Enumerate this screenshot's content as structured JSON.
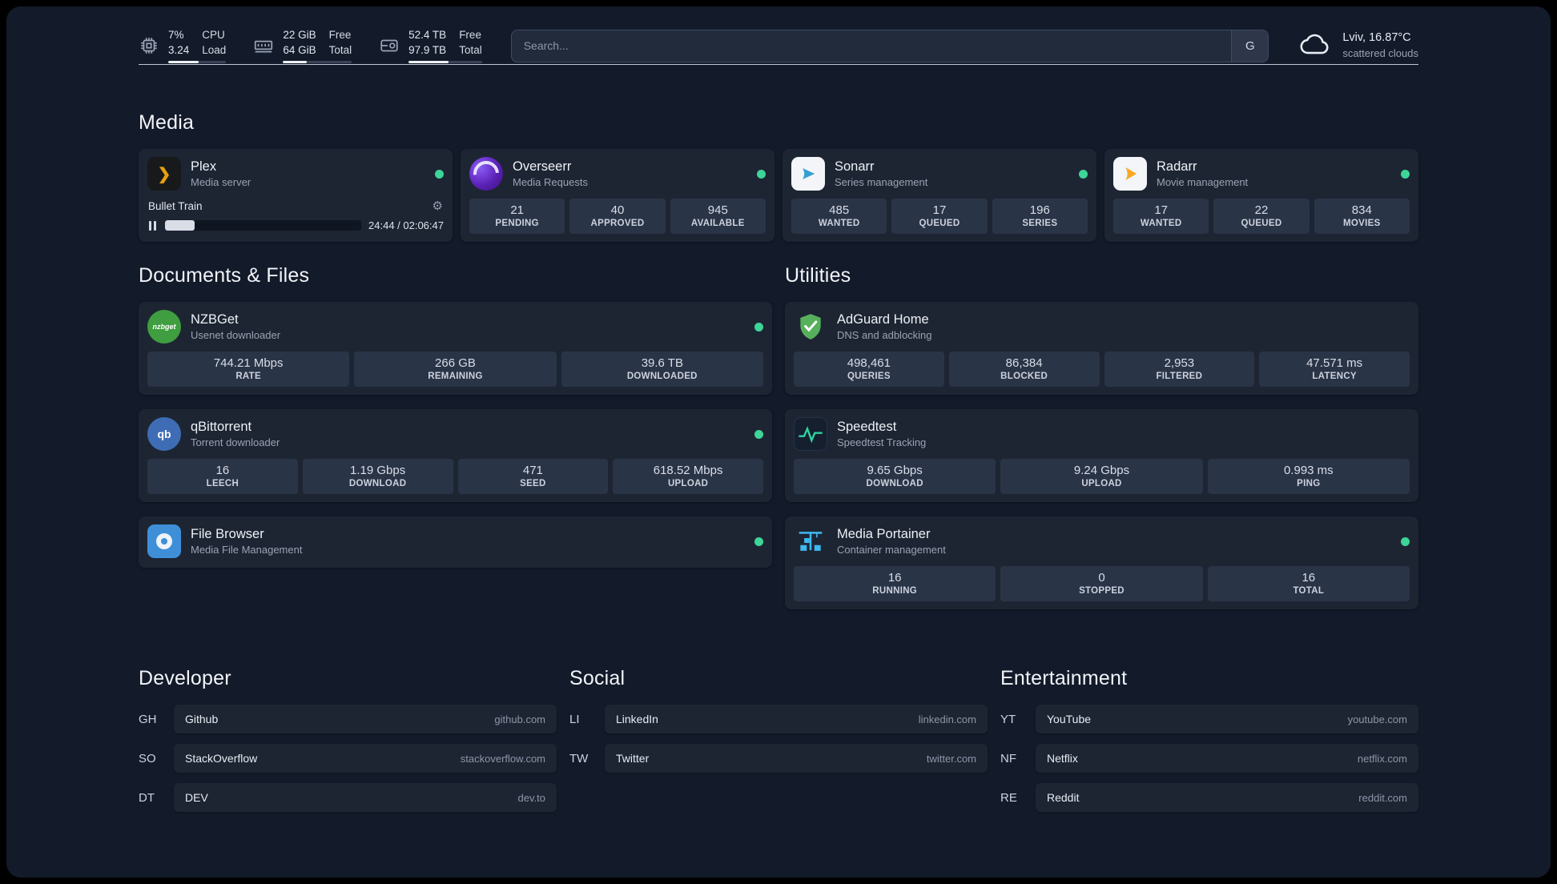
{
  "header": {
    "cpu": {
      "usage": "7%",
      "load": "3.24",
      "label_top": "CPU",
      "label_bottom": "Load",
      "bar_pct": 53
    },
    "memory": {
      "free": "22 GiB",
      "total": "64 GiB",
      "label_top": "Free",
      "label_bottom": "Total",
      "bar_pct": 34
    },
    "disk": {
      "free": "52.4 TB",
      "total": "97.9 TB",
      "label_top": "Free",
      "label_bottom": "Total",
      "bar_pct": 54
    },
    "search": {
      "placeholder": "Search...",
      "provider_button": "G"
    },
    "weather": {
      "location": "Lviv, 16.87°C",
      "condition": "scattered clouds"
    }
  },
  "media": {
    "title": "Media",
    "plex": {
      "name": "Plex",
      "subtitle": "Media server",
      "status": "online",
      "now_playing": {
        "title": "Bullet Train",
        "time": "24:44 / 02:06:47",
        "progress_pct": 15
      }
    },
    "overseerr": {
      "name": "Overseerr",
      "subtitle": "Media Requests",
      "status": "online",
      "stats": [
        {
          "value": "21",
          "label": "PENDING"
        },
        {
          "value": "40",
          "label": "APPROVED"
        },
        {
          "value": "945",
          "label": "AVAILABLE"
        }
      ]
    },
    "sonarr": {
      "name": "Sonarr",
      "subtitle": "Series management",
      "status": "online",
      "stats": [
        {
          "value": "485",
          "label": "WANTED"
        },
        {
          "value": "17",
          "label": "QUEUED"
        },
        {
          "value": "196",
          "label": "SERIES"
        }
      ]
    },
    "radarr": {
      "name": "Radarr",
      "subtitle": "Movie management",
      "status": "online",
      "stats": [
        {
          "value": "17",
          "label": "WANTED"
        },
        {
          "value": "22",
          "label": "QUEUED"
        },
        {
          "value": "834",
          "label": "MOVIES"
        }
      ]
    }
  },
  "documents": {
    "title": "Documents & Files",
    "nzbget": {
      "name": "NZBGet",
      "subtitle": "Usenet downloader",
      "status": "online",
      "stats": [
        {
          "value": "744.21 Mbps",
          "label": "RATE"
        },
        {
          "value": "266 GB",
          "label": "REMAINING"
        },
        {
          "value": "39.6 TB",
          "label": "DOWNLOADED"
        }
      ]
    },
    "qbittorrent": {
      "name": "qBittorrent",
      "subtitle": "Torrent downloader",
      "status": "online",
      "stats": [
        {
          "value": "16",
          "label": "LEECH"
        },
        {
          "value": "1.19 Gbps",
          "label": "DOWNLOAD"
        },
        {
          "value": "471",
          "label": "SEED"
        },
        {
          "value": "618.52 Mbps",
          "label": "UPLOAD"
        }
      ]
    },
    "filebrowser": {
      "name": "File Browser",
      "subtitle": "Media File Management",
      "status": "online"
    }
  },
  "utilities": {
    "title": "Utilities",
    "adguard": {
      "name": "AdGuard Home",
      "subtitle": "DNS and adblocking",
      "stats": [
        {
          "value": "498,461",
          "label": "QUERIES"
        },
        {
          "value": "86,384",
          "label": "BLOCKED"
        },
        {
          "value": "2,953",
          "label": "FILTERED"
        },
        {
          "value": "47.571 ms",
          "label": "LATENCY"
        }
      ]
    },
    "speedtest": {
      "name": "Speedtest",
      "subtitle": "Speedtest Tracking",
      "stats": [
        {
          "value": "9.65 Gbps",
          "label": "DOWNLOAD"
        },
        {
          "value": "9.24 Gbps",
          "label": "UPLOAD"
        },
        {
          "value": "0.993 ms",
          "label": "PING"
        }
      ]
    },
    "portainer": {
      "name": "Media Portainer",
      "subtitle": "Container management",
      "status": "online",
      "stats": [
        {
          "value": "16",
          "label": "RUNNING"
        },
        {
          "value": "0",
          "label": "STOPPED"
        },
        {
          "value": "16",
          "label": "TOTAL"
        }
      ]
    }
  },
  "bookmarks": {
    "developer": {
      "title": "Developer",
      "items": [
        {
          "abbr": "GH",
          "name": "Github",
          "url": "github.com"
        },
        {
          "abbr": "SO",
          "name": "StackOverflow",
          "url": "stackoverflow.com"
        },
        {
          "abbr": "DT",
          "name": "DEV",
          "url": "dev.to"
        }
      ]
    },
    "social": {
      "title": "Social",
      "items": [
        {
          "abbr": "LI",
          "name": "LinkedIn",
          "url": "linkedin.com"
        },
        {
          "abbr": "TW",
          "name": "Twitter",
          "url": "twitter.com"
        }
      ]
    },
    "entertainment": {
      "title": "Entertainment",
      "items": [
        {
          "abbr": "YT",
          "name": "YouTube",
          "url": "youtube.com"
        },
        {
          "abbr": "NF",
          "name": "Netflix",
          "url": "netflix.com"
        },
        {
          "abbr": "RE",
          "name": "Reddit",
          "url": "reddit.com"
        }
      ]
    }
  },
  "icons": {
    "plex_glyph": "❯",
    "nzbget_text": "nzbget",
    "qbittorrent_text": "qb"
  },
  "colors": {
    "status_online": "#3dd598",
    "plex_gold": "#e5a00d",
    "background": "#131a2a",
    "card": "#1d2533"
  }
}
